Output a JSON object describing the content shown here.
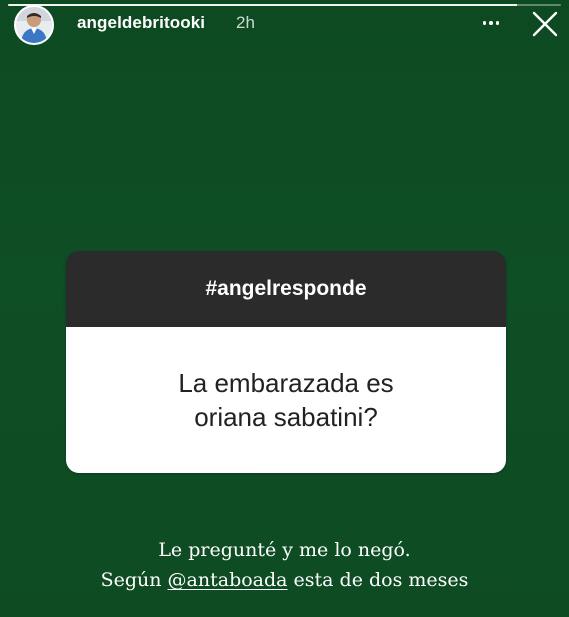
{
  "story": {
    "username": "angeldebritooki",
    "time_ago": "2h",
    "progress": 0.92
  },
  "header": {
    "more_icon": "more-horizontal-icon",
    "close_icon": "close-icon"
  },
  "question_sticker": {
    "hashtag": "#angelresponde",
    "question": "La embarazada es oriana sabatini?"
  },
  "caption": {
    "line1": "Le pregunté y me lo negó.",
    "line2_prefix": "Según ",
    "mention": "@antaboada",
    "line2_suffix": " esta de dos meses"
  },
  "colors": {
    "background": "#0f4d24",
    "card_header": "#2b2b2b",
    "card_body": "#ffffff",
    "text": "#ffffff"
  }
}
